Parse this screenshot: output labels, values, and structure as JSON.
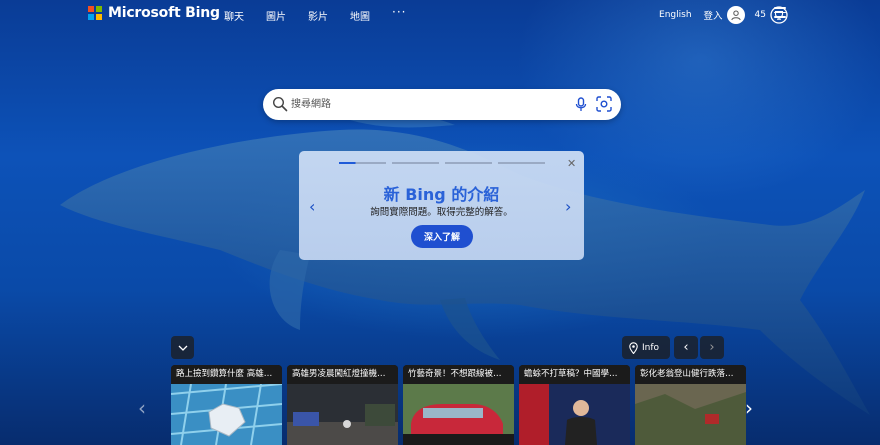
{
  "header": {
    "brand": "Microsoft Bing",
    "nav": [
      "聊天",
      "圖片",
      "影片",
      "地圖"
    ],
    "more": "···",
    "language": "English",
    "signin": "登入",
    "points": "45"
  },
  "search": {
    "placeholder": "搜尋網路"
  },
  "promo": {
    "title": "新 Bing 的介紹",
    "subtitle": "詢問實際問題。取得完整的解答。",
    "cta": "深入了解",
    "close": "✕",
    "prev": "‹",
    "next": "›"
  },
  "controls": {
    "info": "Info"
  },
  "news": [
    {
      "caption": "路上撿到鑽算什麼 高雄鳳..."
    },
    {
      "caption": "高雄男凌晨闖紅燈撞機車 ..."
    },
    {
      "caption": "竹藝奇景！不想跟線被檢..."
    },
    {
      "caption": "蟾蜍不打草稿？中國學者：..."
    },
    {
      "caption": "彰化老翁登山健行跌落山..."
    }
  ],
  "colors": {
    "accent": "#1f4fd0",
    "title_blue": "#2a62d8",
    "ms_red": "#f25022",
    "ms_green": "#7fba00",
    "ms_blue": "#00a4ef",
    "ms_yellow": "#ffb900"
  }
}
